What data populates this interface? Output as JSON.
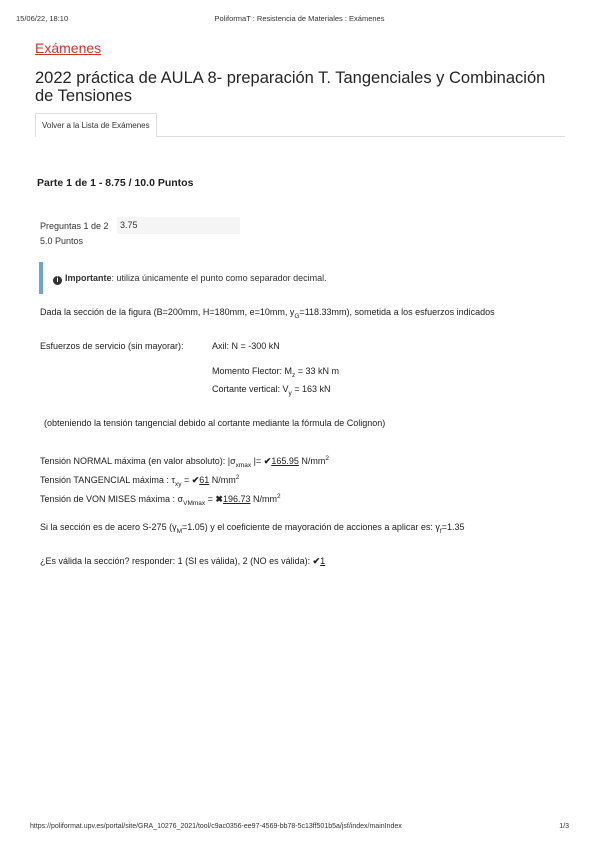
{
  "print_header": {
    "timestamp": "15/06/22, 18:10",
    "title": "PoliformaT : Resistencia de Materiales : Exámenes"
  },
  "breadcrumb": "Exámenes",
  "title": "2022 práctica de AULA 8- preparación T. Tangenciales y Combinación de Tensiones",
  "back_button": "Volver a la Lista de Exámenes",
  "part_heading": "Parte 1 de 1 - 8.75 / 10.0 Puntos",
  "question": {
    "number": "Preguntas 1 de 2",
    "score": "3.75",
    "points": "5.0 Puntos"
  },
  "notice": {
    "strong": "Importante",
    "text": ": utiliza únicamente el punto como separador decimal."
  },
  "statement": {
    "prefix": "Dada la sección de la figura (B=200mm, H=180mm, e=10mm, y",
    "sub": "G",
    "suffix": "=118.33mm), sometida a los esfuerzos indicados"
  },
  "loads": {
    "label": "Esfuerzos de servicio (sin mayorar):",
    "axial": "Axil:  N = -300 kN",
    "moment_prefix": "Momento Flector:  M",
    "moment_sub": "z",
    "moment_suffix": " = 33 kN m",
    "shear_prefix": "Cortante vertical:  V",
    "shear_sub": "y",
    "shear_suffix": " = 163 kN"
  },
  "colignon_note": "(obteniendo la tensión tangencial debido al cortante mediante la fórmula de Colignon)",
  "results": [
    {
      "label": "Tensión NORMAL máxima (en valor absoluto):  |σ",
      "sub": "xmax",
      "after_sub": " |= ",
      "mark": "✔",
      "answer": "165.95",
      "unit": " N/mm",
      "sup": "2"
    },
    {
      "label": "Tensión TANGENCIAL máxima :  τ",
      "sub": "xy",
      "after_sub": " = ",
      "mark": "✔",
      "answer": "61",
      "unit": " N/mm",
      "sup": "2"
    },
    {
      "label": "Tensión de VON MISES máxima :  σ",
      "sub": "VMmax",
      "after_sub": " = ",
      "mark": "✖",
      "answer": "196.73",
      "unit": " N/mm",
      "sup": "2"
    }
  ],
  "steel": {
    "prefix": "Si la sección es de acero S-275 (γ",
    "sub1": "M",
    "mid": "=1.05) y el coeficiente de mayoración de acciones a aplicar es: γ",
    "sub2": "f",
    "suffix": "=1.35"
  },
  "validity": {
    "question": "¿Es válida la sección? responder: 1 (SI es válida), 2 (NO es válida): ",
    "mark": "✔",
    "answer": "1"
  },
  "print_footer": {
    "url": "https://poliformat.upv.es/portal/site/GRA_10276_2021/tool/c9ac0356-ee97-4569-bb78-5c13ff501b5a/jsf/index/mainIndex",
    "page": "1/3"
  }
}
